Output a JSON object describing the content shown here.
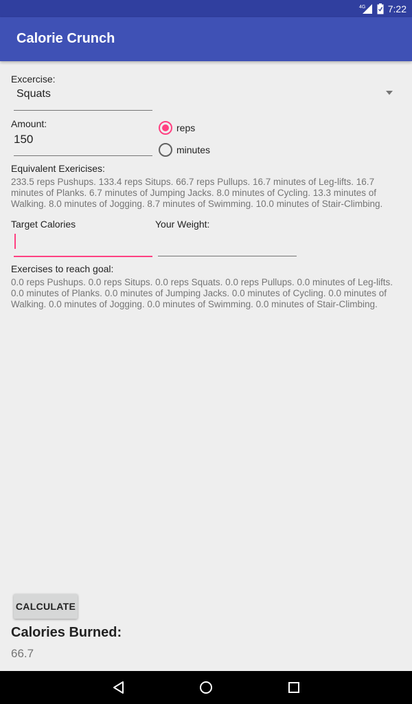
{
  "status_bar": {
    "network": "4G",
    "time": "7:22",
    "icons": [
      "signal-icon",
      "battery-icon"
    ]
  },
  "app_bar": {
    "title": "Calorie Crunch"
  },
  "exercise": {
    "label": "Excercise:",
    "selected": "Squats"
  },
  "amount": {
    "label": "Amount:",
    "value": "150",
    "unit_options": [
      {
        "label": "reps",
        "checked": true
      },
      {
        "label": "minutes",
        "checked": false
      }
    ]
  },
  "equivalent": {
    "label": "Equivalent Exericises:",
    "text": "233.5 reps Pushups. 133.4 reps Situps. 66.7 reps Pullups. 16.7 minutes of Leg-lifts. 16.7 minutes of Planks. 6.7 minutes of Jumping Jacks. 8.0 minutes of Cycling. 13.3 minutes of Walking. 8.0 minutes of Jogging. 8.7 minutes of Swimming. 10.0 minutes of Stair-Climbing."
  },
  "target": {
    "label": "Target Calories",
    "value": ""
  },
  "weight": {
    "label": "Your Weight:",
    "value": ""
  },
  "goal": {
    "label": "Exercises to reach goal:",
    "text": "0.0 reps Pushups. 0.0 reps Situps. 0.0 reps Squats. 0.0 reps Pullups. 0.0 minutes of Leg-lifts. 0.0 minutes of Planks. 0.0 minutes of Jumping Jacks. 0.0 minutes of Cycling. 0.0 minutes of Walking. 0.0 minutes of Jogging. 0.0 minutes of Swimming. 0.0 minutes of Stair-Climbing."
  },
  "calculate_button": "CALCULATE",
  "calories_burned": {
    "label": "Calories Burned:",
    "value": "66.7"
  },
  "nav_bar": {
    "buttons": [
      "back-icon",
      "home-icon",
      "recents-icon"
    ]
  },
  "colors": {
    "primary": "#3f51b5",
    "primary_dark": "#303f9f",
    "accent": "#ff4081",
    "background": "#eeeeee"
  }
}
